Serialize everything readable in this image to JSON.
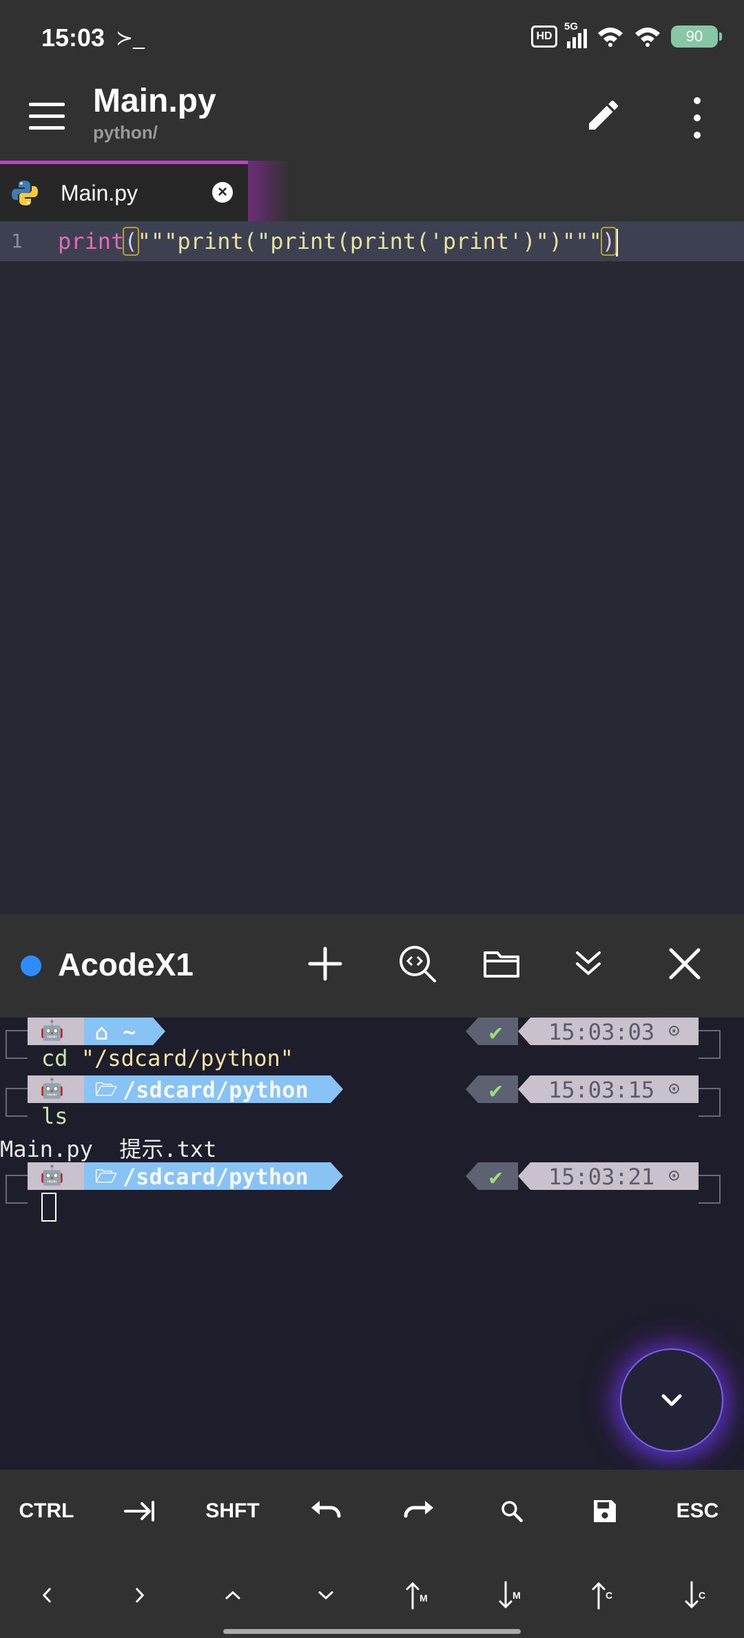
{
  "status_bar": {
    "time": "15:03",
    "terminal_glyph": "≻_",
    "hd_label": "HD",
    "network_label": "5G",
    "battery": "90",
    "battery_color": "#86c7a5"
  },
  "app_bar": {
    "title": "Main.py",
    "subtitle": "python/"
  },
  "tabs": [
    {
      "label": "Main.py",
      "icon": "python-icon",
      "active": true
    }
  ],
  "editor": {
    "line_number": "1",
    "tokens": {
      "keyword": "print",
      "open_paren": "(",
      "string": "\"\"\"print(\"print(print('print')\")\"\"\"",
      "close_paren": ")"
    }
  },
  "terminal_panel": {
    "title": "AcodeX1",
    "status_color": "#2f8cff"
  },
  "terminal": {
    "prompts": [
      {
        "path_icon": "⌂",
        "path": "~",
        "status": "✔",
        "time": "15:03:03",
        "clock": "⊙"
      },
      {
        "path_icon": "🗁",
        "path": "/sdcard/python",
        "status": "✔",
        "time": "15:03:15",
        "clock": "⊙"
      },
      {
        "path_icon": "🗁",
        "path": "/sdcard/python",
        "status": "✔",
        "time": "15:03:21",
        "clock": "⊙"
      }
    ],
    "commands": [
      {
        "cmd": "cd",
        "arg": "\"/sdcard/python\""
      },
      {
        "cmd": "ls",
        "arg": ""
      }
    ],
    "output": "Main.py  提示.txt"
  },
  "keys_row1": [
    {
      "label": "CTRL",
      "icon": ""
    },
    {
      "label": "",
      "icon": "tab-icon"
    },
    {
      "label": "SHFT",
      "icon": ""
    },
    {
      "label": "",
      "icon": "undo-icon"
    },
    {
      "label": "",
      "icon": "redo-icon"
    },
    {
      "label": "",
      "icon": "search-icon"
    },
    {
      "label": "",
      "icon": "save-icon"
    },
    {
      "label": "ESC",
      "icon": ""
    }
  ],
  "keys_row2": [
    {
      "icon": "arrow-left-icon"
    },
    {
      "icon": "arrow-right-icon"
    },
    {
      "icon": "arrow-up-icon"
    },
    {
      "icon": "arrow-down-icon"
    },
    {
      "icon": "move-up-icon"
    },
    {
      "icon": "move-down-icon"
    },
    {
      "icon": "copy-up-icon"
    },
    {
      "icon": "copy-down-icon"
    }
  ]
}
